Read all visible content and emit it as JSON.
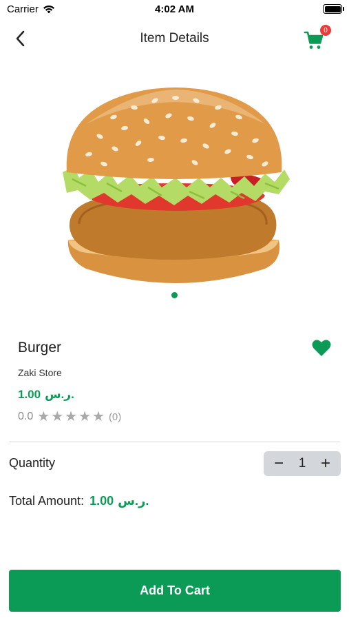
{
  "status_bar": {
    "carrier": "Carrier",
    "time": "4:02 AM"
  },
  "nav": {
    "title": "Item Details",
    "cart_badge": "0"
  },
  "product": {
    "name": "Burger",
    "store": "Zaki Store",
    "price_amount": "1.00",
    "currency": "ر.س.",
    "rating": "0.0",
    "review_count": "(0)",
    "image_icon": "burger-image",
    "favorite_icon": "heart-icon"
  },
  "quantity": {
    "label": "Quantity",
    "value": "1",
    "minus": "−",
    "plus": "+"
  },
  "total": {
    "label": "Total Amount:",
    "amount": "1.00",
    "currency": "ر.س."
  },
  "actions": {
    "add_to_cart": "Add To Cart"
  },
  "colors": {
    "accent": "#0c9b56",
    "badge": "#ea3b3b",
    "stepper_bg": "#d3d6da"
  }
}
